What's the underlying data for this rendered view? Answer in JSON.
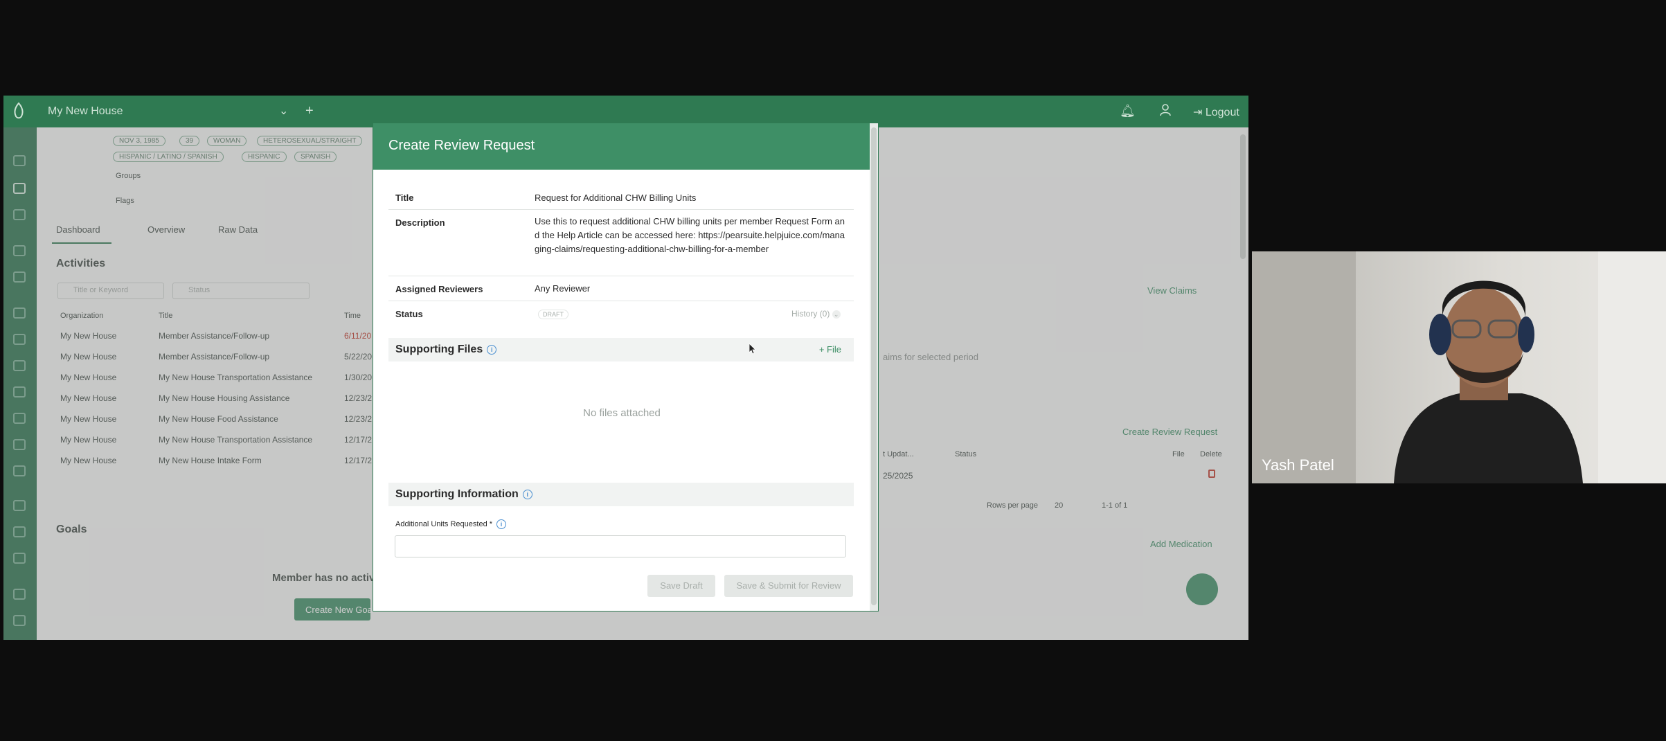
{
  "topbar": {
    "org_name": "My New House",
    "logout_label": "Logout"
  },
  "profile": {
    "chips_row1": [
      "NOV 3, 1985",
      "39",
      "WOMAN",
      "HETEROSEXUAL/STRAIGHT"
    ],
    "chips_row2": [
      "HISPANIC / LATINO / SPANISH",
      "HISPANIC",
      "SPANISH"
    ],
    "groups_label": "Groups",
    "flags_label": "Flags"
  },
  "tabs": [
    "Dashboard",
    "Overview",
    "Raw Data"
  ],
  "activities": {
    "title": "Activities",
    "search_placeholder": "Title or Keyword",
    "filter_placeholder": "Status",
    "columns": [
      "Organization",
      "Title",
      "Time"
    ],
    "rows": [
      {
        "org": "My New House",
        "title": "Member Assistance/Follow-up",
        "time": "6/11/20"
      },
      {
        "org": "My New House",
        "title": "Member Assistance/Follow-up",
        "time": "5/22/20"
      },
      {
        "org": "My New House",
        "title": "My New House Transportation Assistance",
        "time": "1/30/20"
      },
      {
        "org": "My New House",
        "title": "My New House Housing Assistance",
        "time": "12/23/2"
      },
      {
        "org": "My New House",
        "title": "My New House Food Assistance",
        "time": "12/23/2"
      },
      {
        "org": "My New House",
        "title": "My New House Transportation Assistance",
        "time": "12/17/2"
      },
      {
        "org": "My New House",
        "title": "My New House Intake Form",
        "time": "12/17/2"
      }
    ]
  },
  "goals": {
    "title": "Goals",
    "empty_text": "Member has no activ",
    "create_button": "Create New Goa"
  },
  "right_panel": {
    "view_claims": "View Claims",
    "no_claims_text": "aims for selected period",
    "create_review_request": "Create Review Request",
    "columns": [
      "t Updat...",
      "Status",
      "File",
      "Delete"
    ],
    "row_date": "25/2025",
    "rows_per_page_label": "Rows per page",
    "rows_per_page_value": "20",
    "pagination": "1-1 of 1",
    "add_medication": "Add Medication"
  },
  "modal": {
    "header": "Create Review Request",
    "title_label": "Title",
    "title_value": "Request for Additional CHW Billing Units",
    "description_label": "Description",
    "description_value": "Use this to request additional CHW billing units per member Request Form and the Help Article can be accessed here: https://pearsuite.helpjuice.com/managing-claims/requesting-additional-chw-billing-for-a-member",
    "reviewers_label": "Assigned Reviewers",
    "reviewers_value": "Any Reviewer",
    "status_label": "Status",
    "status_value": "DRAFT",
    "history_label": "History (0)",
    "supporting_files_title": "Supporting Files",
    "add_file_label": "+ File",
    "no_files_text": "No files attached",
    "supporting_info_title": "Supporting Information",
    "units_label": "Additional Units Requested *",
    "units_value": "",
    "save_draft_label": "Save Draft",
    "submit_label": "Save & Submit for Review"
  },
  "webcam": {
    "participant_name": "Yash Patel"
  },
  "colors": {
    "brand_green": "#2f7a52",
    "modal_header": "#3e8f66",
    "accent_red": "#c0392b"
  }
}
